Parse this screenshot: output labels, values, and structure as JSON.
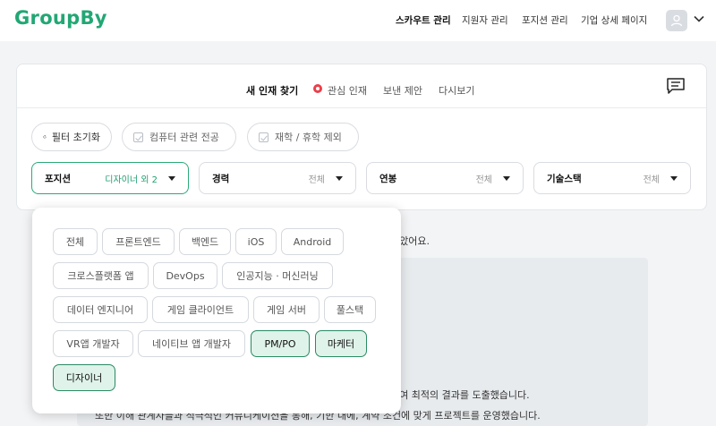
{
  "header": {
    "logo": "GroupBy",
    "nav": [
      {
        "label": "스카우트 관리",
        "active": true
      },
      {
        "label": "지원자 관리",
        "active": false
      },
      {
        "label": "포지션 관리",
        "active": false
      },
      {
        "label": "기업 상세 페이지",
        "active": false
      }
    ]
  },
  "tabs": [
    {
      "label": "새 인재 찾기",
      "active": true
    },
    {
      "label": "관심 인재",
      "active": false
    },
    {
      "label": "보낸 제안",
      "active": false
    },
    {
      "label": "다시보기",
      "active": false
    }
  ],
  "filters": {
    "reset_label": "필터 초기화",
    "checkbox_1": "컴퓨터 관련 전공",
    "checkbox_2": "재학 / 휴학 제외"
  },
  "selects": [
    {
      "label": "포지션",
      "value": "디자이너 외 2"
    },
    {
      "label": "경력",
      "value": "전체"
    },
    {
      "label": "연봉",
      "value": "전체"
    },
    {
      "label": "기술스택",
      "value": "전체"
    }
  ],
  "position_options": [
    {
      "label": "전체",
      "selected": false
    },
    {
      "label": "프론트엔드",
      "selected": false
    },
    {
      "label": "백엔드",
      "selected": false
    },
    {
      "label": "iOS",
      "selected": false
    },
    {
      "label": "Android",
      "selected": false
    },
    {
      "label": "크로스플랫폼 앱",
      "selected": false
    },
    {
      "label": "DevOps",
      "selected": false
    },
    {
      "label": "인공지능 · 머신러닝",
      "selected": false
    },
    {
      "label": "데이터 엔지니어",
      "selected": false
    },
    {
      "label": "게임 클라이언트",
      "selected": false
    },
    {
      "label": "게임 서버",
      "selected": false
    },
    {
      "label": "풀스택",
      "selected": false
    },
    {
      "label": "VR앱 개발자",
      "selected": false
    },
    {
      "label": "네이티브 앱 개발자",
      "selected": false
    },
    {
      "label": "PM/PO",
      "selected": true
    },
    {
      "label": "마케터",
      "selected": true
    },
    {
      "label": "디자이너",
      "selected": true
    }
  ],
  "background": {
    "result_text_fragment": "찾았어요.",
    "line_1": "하여 최적의 결과를 도출했습니다.",
    "line_2": "또한 이해 관계자들과 적극적인 커뮤니케이션을 통해, 기한 내에, 계약 조건에 맞게 프로젝트를 운영했습니다."
  },
  "colors": {
    "brand": "#22a774",
    "selected_bg": "#dff3ea",
    "selected_border": "#2a8a64",
    "interest_dot": "#e9404a"
  }
}
